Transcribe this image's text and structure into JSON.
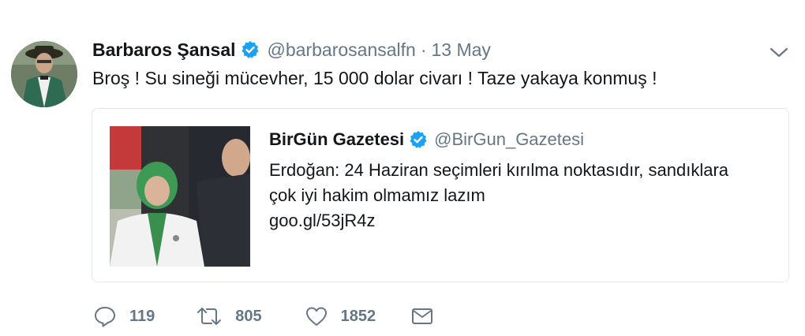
{
  "tweet": {
    "author_name": "Barbaros Şansal",
    "author_handle": "@barbarosansalfn",
    "separator": "·",
    "date": "13 May",
    "text": "Broş ! Su sineği mücevher, 15 000 dolar civarı ! Taze yakaya konmuş !"
  },
  "quoted": {
    "author_name": "BirGün Gazetesi",
    "author_handle": "@BirGun_Gazetesi",
    "text_line1": "Erdoğan: 24 Haziran seçimleri kırılma noktasıdır, sandıklara",
    "text_line2": "çok iyi hakim olmamız lazım",
    "link": "goo.gl/53jR4z"
  },
  "actions": {
    "replies": "119",
    "retweets": "805",
    "likes": "1852"
  },
  "colors": {
    "verified": "#1da1f2",
    "muted": "#657786",
    "text": "#14171a",
    "border": "#e1e8ed"
  },
  "icons": [
    "verified-badge-icon",
    "chevron-down-icon",
    "reply-icon",
    "retweet-icon",
    "like-icon",
    "direct-message-icon"
  ]
}
